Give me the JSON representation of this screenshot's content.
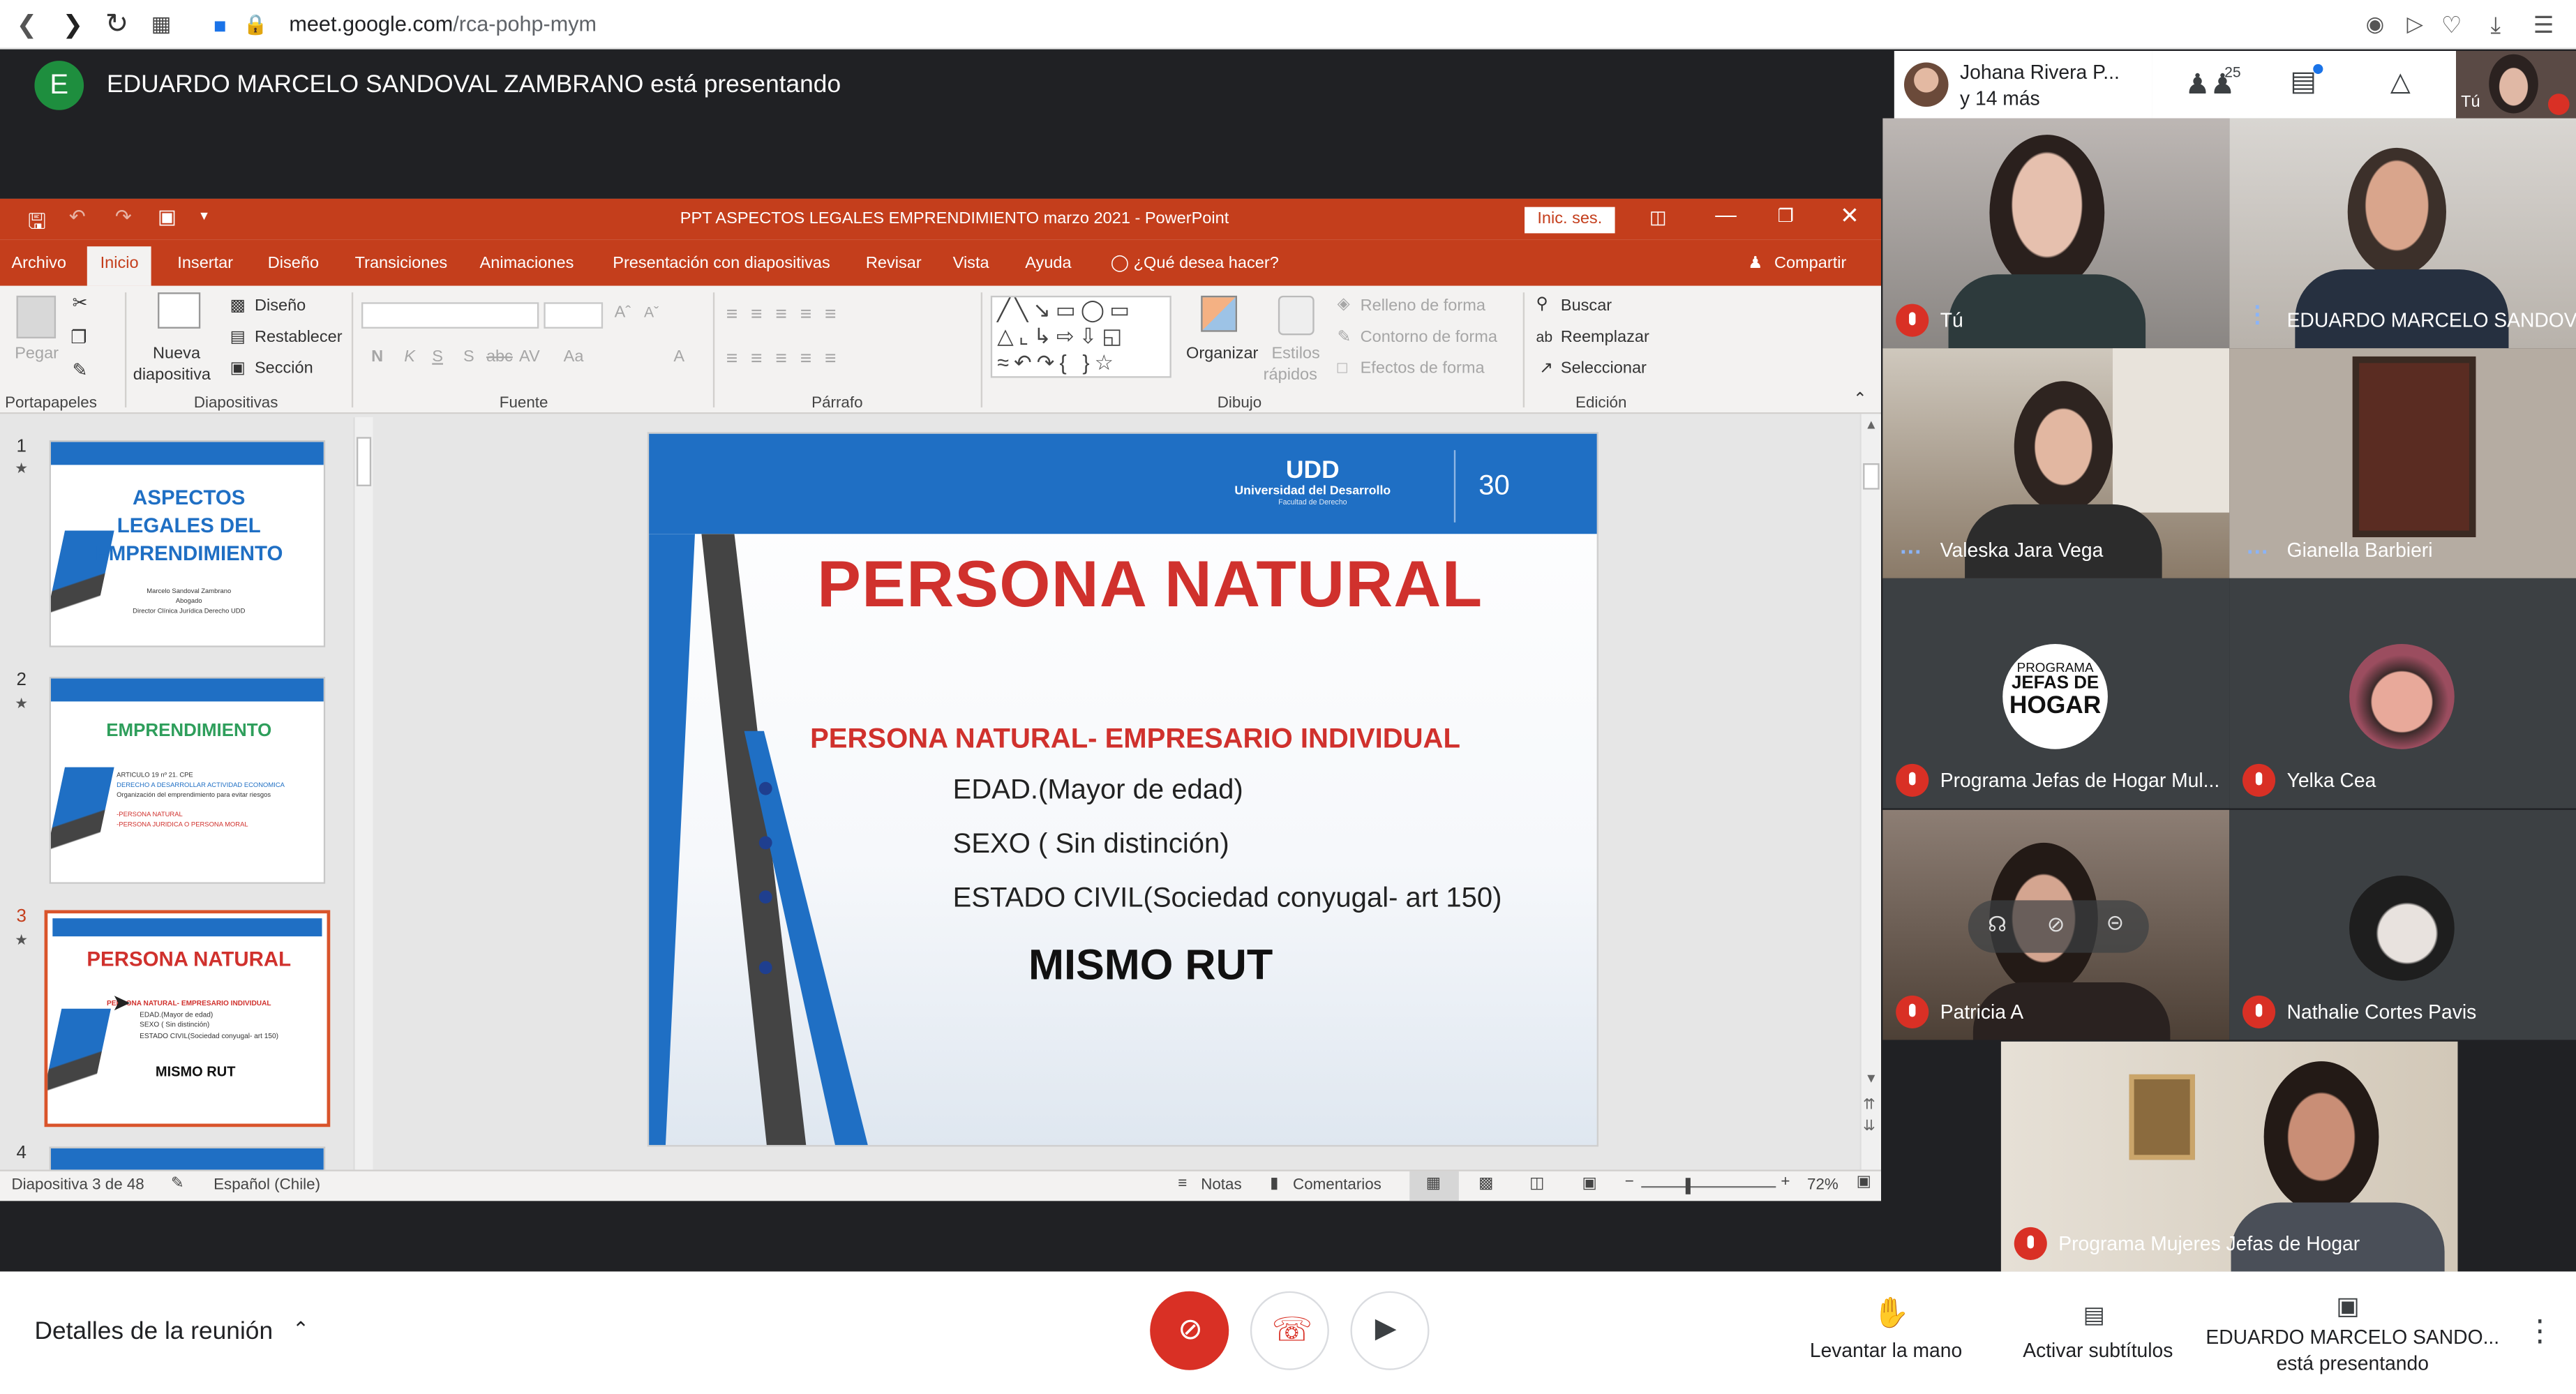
{
  "browser": {
    "url_host": "meet.google.com",
    "url_path": "/rca-pohp-mym"
  },
  "meet": {
    "presenter_initial": "E",
    "presenter_banner": "EDUARDO MARCELO SANDOVAL ZAMBRANO está presentando",
    "header_participant": "Johana Rivera P...",
    "header_more": "y 14 más",
    "people_count": "25",
    "self_label": "Tú",
    "tiles": [
      {
        "name": "Tú"
      },
      {
        "name": "EDUARDO MARCELO SANDOV..."
      },
      {
        "name": "Valeska Jara Vega"
      },
      {
        "name": "Gianella Barbieri"
      },
      {
        "name": "Programa Jefas de Hogar Mul..."
      },
      {
        "name": "Yelka Cea"
      },
      {
        "name": "Patricia A"
      },
      {
        "name": "Nathalie Cortes Pavis"
      },
      {
        "name": "Programa Mujeres Jefas de Hogar"
      }
    ],
    "jefas_logo": {
      "top": "PROGRAMA",
      "mid": "JEFAS DE",
      "bottom": "HOGAR"
    },
    "bottom": {
      "details": "Detalles de la reunión",
      "raise_hand": "Levantar la mano",
      "captions": "Activar subtítulos",
      "presenting_name": "EDUARDO MARCELO SANDO...",
      "presenting_status": "está presentando"
    },
    "colors": {
      "accent_red": "#d93025",
      "dark_bg": "#202124"
    }
  },
  "ppt": {
    "title": "PPT ASPECTOS LEGALES EMPRENDIMIENTO  marzo 2021  -  PowerPoint",
    "signin": "Inic. ses.",
    "tabs": [
      "Archivo",
      "Inicio",
      "Insertar",
      "Diseño",
      "Transiciones",
      "Animaciones",
      "Presentación con diapositivas",
      "Revisar",
      "Vista",
      "Ayuda"
    ],
    "tell_me": "¿Qué desea hacer?",
    "share": "Compartir",
    "ribbon": {
      "paste": "Pegar",
      "new_slide_1": "Nueva",
      "new_slide_2": "diapositiva",
      "layout": "Diseño",
      "reset": "Restablecer",
      "section": "Sección",
      "arrange": "Organizar",
      "quick_styles_1": "Estilos",
      "quick_styles_2": "rápidos",
      "shape_fill": "Relleno de forma",
      "shape_outline": "Contorno de forma",
      "shape_effects": "Efectos de forma",
      "find": "Buscar",
      "replace": "Reemplazar",
      "select": "Seleccionar",
      "groups": {
        "clipboard": "Portapapeles",
        "slides": "Diapositivas",
        "font": "Fuente",
        "paragraph": "Párrafo",
        "drawing": "Dibujo",
        "editing": "Edición"
      }
    },
    "thumbnails": [
      {
        "num": "1",
        "lines": [
          "ASPECTOS",
          "LEGALES DEL",
          "EMPRENDIMIENTO"
        ],
        "small": [
          "Marcelo Sandoval Zambrano",
          "Abogado",
          "Director Clínica Jurídica Derecho UDD"
        ]
      },
      {
        "num": "2",
        "title": "EMPRENDIMIENTO",
        "small": [
          "ARTICULO 19 nº 21. CPE",
          "DERECHO A DESARROLLAR ACTIVIDAD ECONOMICA",
          "Organización del emprendimiento para evitar riesgos",
          "-PERSONA NATURAL",
          "-PERSONA JURIDICA O PERSONA MORAL"
        ]
      },
      {
        "num": "3",
        "title": "PERSONA NATURAL",
        "small": [
          "PERSONA NATURAL- EMPRESARIO INDIVIDUAL",
          "EDAD.(Mayor de edad)",
          "SEXO ( Sin distinción)",
          "ESTADO CIVIL(Sociedad conyugal- art 150)",
          "MISMO RUT"
        ]
      },
      {
        "num": "4"
      }
    ],
    "slide": {
      "logo_name": "Universidad del Desarrollo",
      "logo_sub": "Facultad de Derecho",
      "logo_mark": "UDD",
      "anniv": "30",
      "title": "PERSONA NATURAL",
      "subtitle": "PERSONA NATURAL- EMPRESARIO INDIVIDUAL",
      "bullets": [
        "EDAD.(Mayor de edad)",
        "SEXO  ( Sin distinción)",
        "ESTADO CIVIL(Sociedad conyugal- art 150)"
      ],
      "emphasis": "MISMO RUT"
    },
    "status": {
      "slide_of": "Diapositiva 3 de 48",
      "language": "Español (Chile)",
      "notes": "Notas",
      "comments": "Comentarios",
      "zoom": "72%"
    },
    "colors": {
      "ppt_orange": "#c43e1c",
      "slide_blue": "#1f6fc4",
      "slide_red": "#d0312d"
    }
  }
}
